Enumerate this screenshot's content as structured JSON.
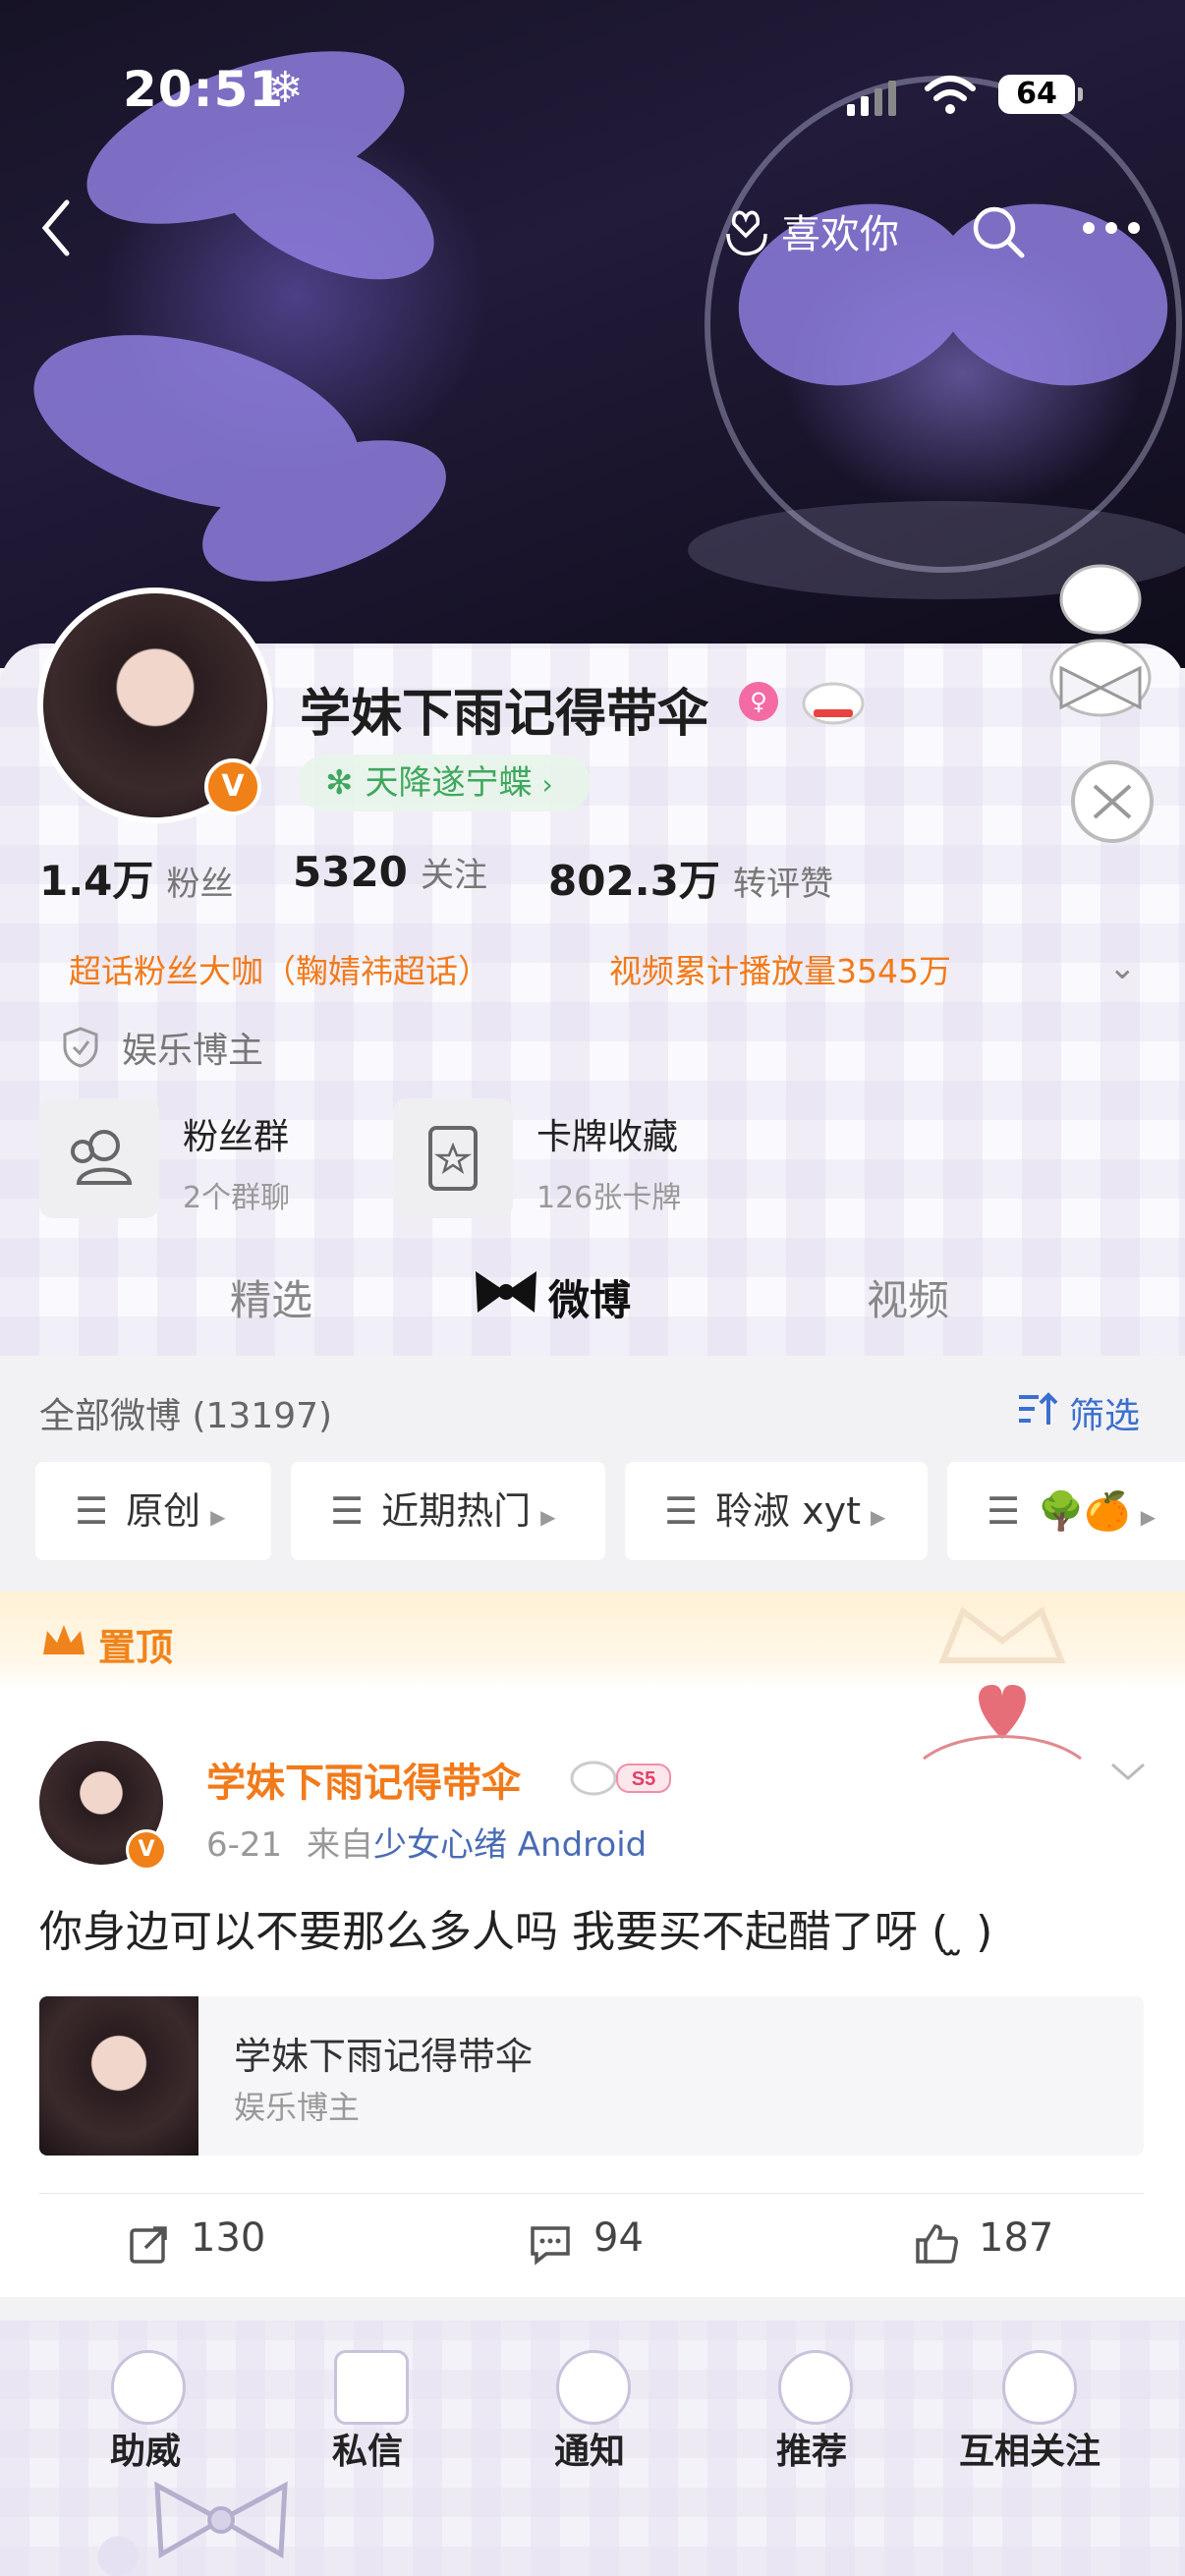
{
  "status_bar": {
    "time": "20:51",
    "battery": "64"
  },
  "header": {
    "like_button": "喜欢你"
  },
  "profile": {
    "name": "学妹下雨记得带伞",
    "tag": "天降遂宁蝶",
    "stats": [
      {
        "num": "1.4万",
        "label": "粉丝"
      },
      {
        "num": "5320",
        "label": "关注"
      },
      {
        "num": "802.3万",
        "label": "转评赞"
      }
    ],
    "honors": [
      "超话粉丝大咖（鞠婧祎超话）",
      "视频累计播放量3545万"
    ],
    "role": "娱乐博主",
    "tiles": [
      {
        "title": "粉丝群",
        "sub": "2个群聊"
      },
      {
        "title": "卡牌收藏",
        "sub": "126张卡牌"
      }
    ]
  },
  "tabs": [
    "精选",
    "微博",
    "视频"
  ],
  "feed": {
    "all_label": "全部微博 (13197)",
    "filter": "筛选",
    "chips": [
      "原创",
      "近期热门",
      "聆淑 xyt",
      "🌳🍊"
    ]
  },
  "post": {
    "pinned": "置顶",
    "author": "学妹下雨记得带伞",
    "date": "6-21",
    "from": "来自",
    "source": "少女心绪 Android",
    "text": "你身边可以不要那么多人吗 我要买不起醋了呀 (  ̫  )",
    "card_title": "学妹下雨记得带伞",
    "card_sub": "娱乐博主",
    "reposts": "130",
    "comments": "94",
    "likes": "187"
  },
  "bottom_nav": [
    "助威",
    "私信",
    "通知",
    "推荐",
    "互相关注"
  ],
  "colors": {
    "accent": "#f27a1a",
    "link": "#4a6bb5",
    "green": "#3fa85e"
  }
}
